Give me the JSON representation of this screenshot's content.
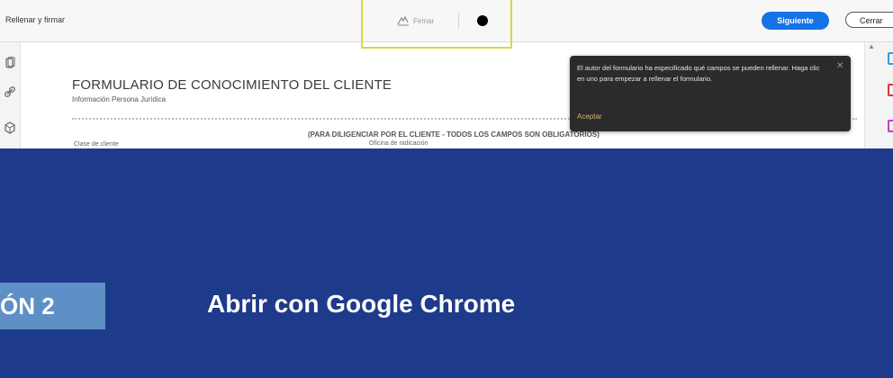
{
  "toolbar": {
    "title": "Rellenar y firmar",
    "sign_label": "Firmar",
    "next_label": "Siguiente",
    "close_label": "Cerrar"
  },
  "document": {
    "title": "FORMULARIO DE CONOCIMIENTO DEL CLIENTE",
    "subtitle": "Información Persona Jurídica",
    "note": "(PARA DILIGENCIAR POR EL CLIENTE - TODOS LOS CAMPOS SON OBLIGATORIOS)",
    "field_client_class": "Clase de cliente",
    "field_office": "Oficina de radicación"
  },
  "tooltip": {
    "text": "El autor del formulario ha especificado qué campos se pueden rellenar. Haga clic en uno para empezar a rellenar el formulario.",
    "ok_label": "Aceptar"
  },
  "banner": {
    "option_label": "ÓN 2",
    "heading": "Abrir con Google Chrome"
  },
  "colors": {
    "banner_bg": "#1e3a8a",
    "badge_bg": "#5e8fc6",
    "primary_button": "#1473e6",
    "highlight": "#d8d840"
  },
  "icons": [
    "sign-icon",
    "color-dot-icon",
    "attachment-icon",
    "link-icon",
    "stamp-icon",
    "close-icon"
  ]
}
